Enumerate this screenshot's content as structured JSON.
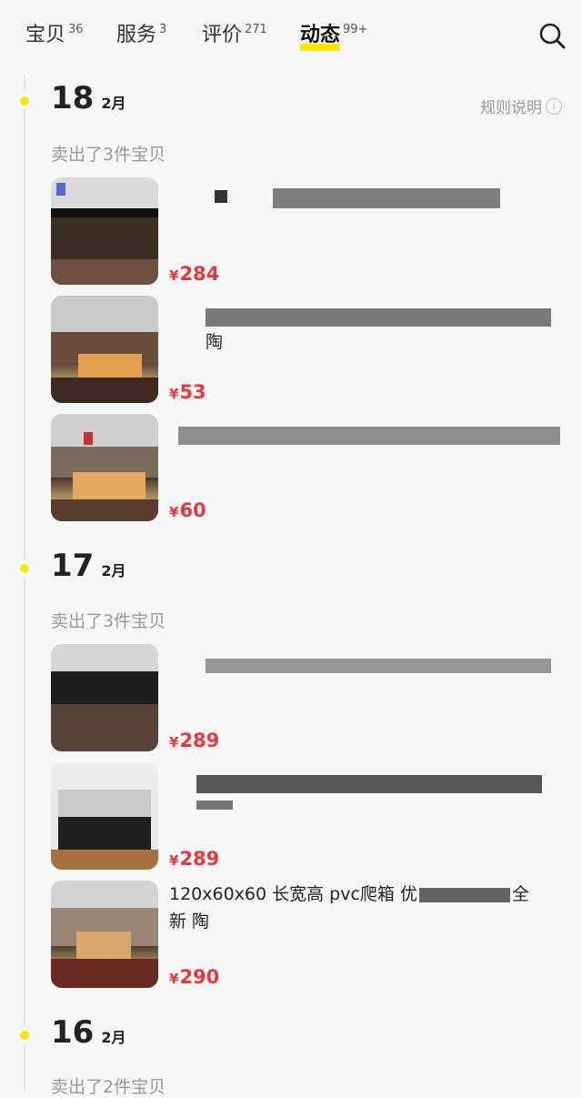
{
  "tabs": [
    {
      "label": "宝贝",
      "count": "36"
    },
    {
      "label": "服务",
      "count": "3"
    },
    {
      "label": "评价",
      "count": "271"
    },
    {
      "label": "动态",
      "count": "99+"
    }
  ],
  "rules_label": "规则说明",
  "sections": [
    {
      "day": "18",
      "month": "2月",
      "sold": "卖出了3件宝贝",
      "items": [
        {
          "price": "284"
        },
        {
          "price": "53",
          "title_fragment": "陶"
        },
        {
          "price": "60"
        }
      ]
    },
    {
      "day": "17",
      "month": "2月",
      "sold": "卖出了3件宝贝",
      "items": [
        {
          "price": "289"
        },
        {
          "price": "289"
        },
        {
          "price": "290",
          "title_line1_start": "120x60x60 长宽高 pvc爬箱 优",
          "title_line1_end": "全",
          "title_line2": "新 陶"
        }
      ]
    },
    {
      "day": "16",
      "month": "2月",
      "sold": "卖出了2件宝贝"
    }
  ],
  "currency": "¥",
  "colors": {
    "accent": "#ffe600",
    "price": "#e8383d",
    "muted": "#999999"
  }
}
